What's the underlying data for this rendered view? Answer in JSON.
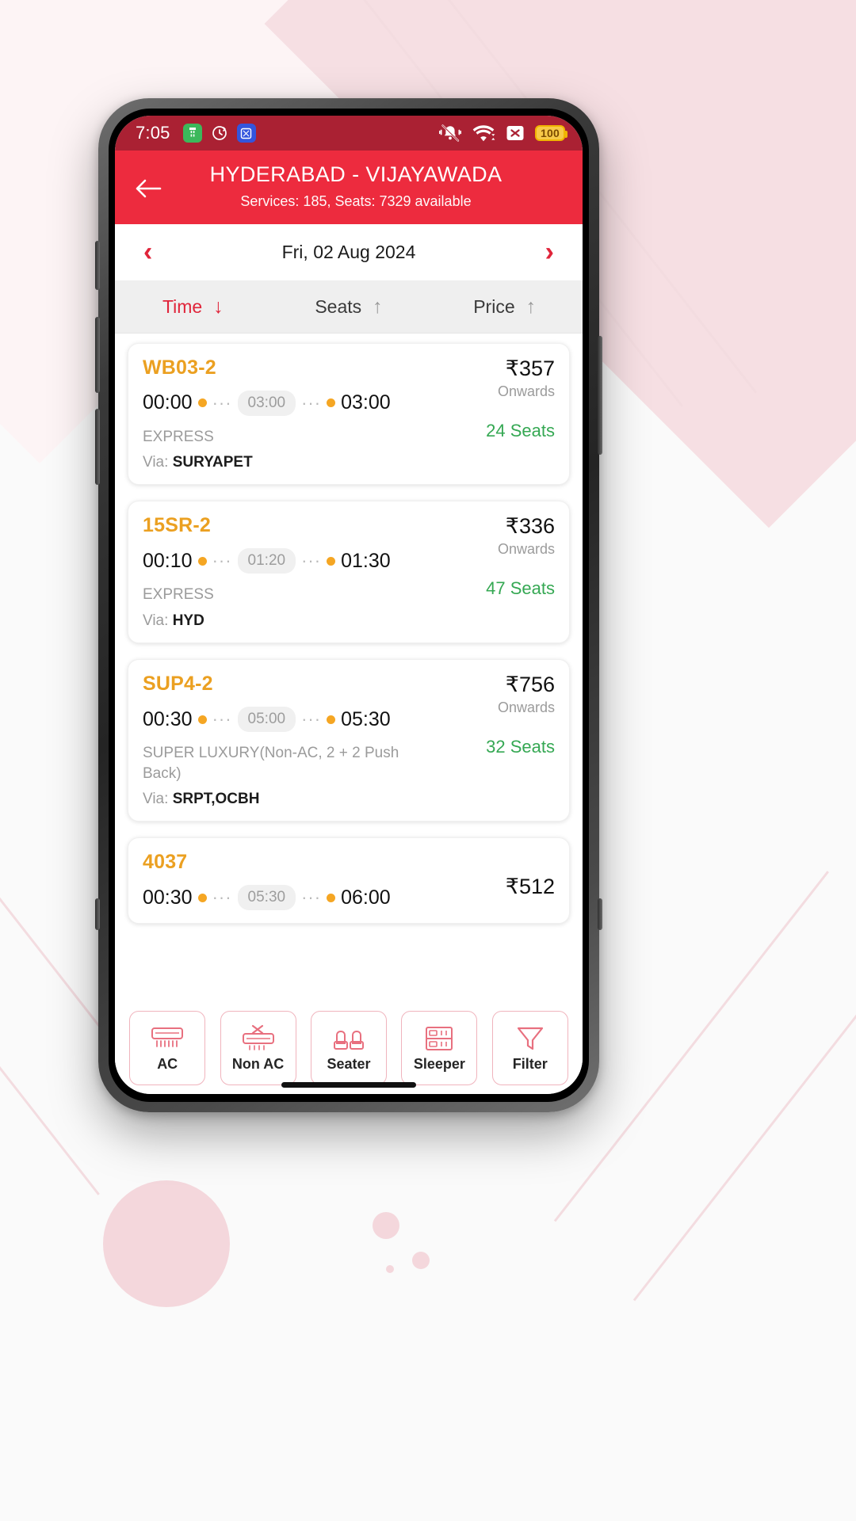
{
  "status_bar": {
    "time": "7:05",
    "left_icons": [
      "battery-saver-icon",
      "sync-icon",
      "screenshot-icon"
    ],
    "right_icons": [
      "mute-bell-icon",
      "wifi-icon",
      "no-signal-icon"
    ],
    "battery_level": "100"
  },
  "app_bar": {
    "back_icon": "back-arrow-icon",
    "title": "HYDERABAD - VIJAYAWADA",
    "subtitle": "Services: 185, Seats: 7329 available",
    "background_color": "#ed2b3e"
  },
  "date_bar": {
    "prev_label": "‹",
    "date": "Fri, 02 Aug 2024",
    "next_label": "›"
  },
  "sort_bar": {
    "items": [
      {
        "label": "Time",
        "arrow": "↓",
        "active": true
      },
      {
        "label": "Seats",
        "arrow": "↑",
        "active": false
      },
      {
        "label": "Price",
        "arrow": "↑",
        "active": false
      }
    ]
  },
  "buses": [
    {
      "service": "WB03-2",
      "depart": "00:00",
      "duration": "03:00",
      "arrive": "03:00",
      "type": "EXPRESS",
      "via_label": "Via:",
      "via_value": "SURYAPET",
      "price": "₹357",
      "onwards": "Onwards",
      "seats": "24 Seats"
    },
    {
      "service": "15SR-2",
      "depart": "00:10",
      "duration": "01:20",
      "arrive": "01:30",
      "type": "EXPRESS",
      "via_label": "Via:",
      "via_value": "HYD",
      "price": "₹336",
      "onwards": "Onwards",
      "seats": "47 Seats"
    },
    {
      "service": "SUP4-2",
      "depart": "00:30",
      "duration": "05:00",
      "arrive": "05:30",
      "type": "SUPER LUXURY(Non-AC, 2 + 2 Push Back)",
      "via_label": "Via:",
      "via_value": "SRPT,OCBH",
      "price": "₹756",
      "onwards": "Onwards",
      "seats": "32 Seats"
    },
    {
      "service": "4037",
      "depart": "00:30",
      "duration": "05:30",
      "arrive": "06:00",
      "type": "",
      "via_label": "",
      "via_value": "",
      "price": "₹512",
      "onwards": "",
      "seats": ""
    }
  ],
  "filter_bar": {
    "buttons": [
      {
        "label": "AC",
        "icon": "ac-unit-icon"
      },
      {
        "label": "Non AC",
        "icon": "non-ac-icon"
      },
      {
        "label": "Seater",
        "icon": "seater-icon"
      },
      {
        "label": "Sleeper",
        "icon": "sleeper-icon"
      },
      {
        "label": "Filter",
        "icon": "funnel-icon"
      }
    ]
  },
  "colors": {
    "brand_red": "#ed2b3e",
    "status_red": "#aa2133",
    "service_orange": "#eba021",
    "seats_green": "#35a853"
  }
}
